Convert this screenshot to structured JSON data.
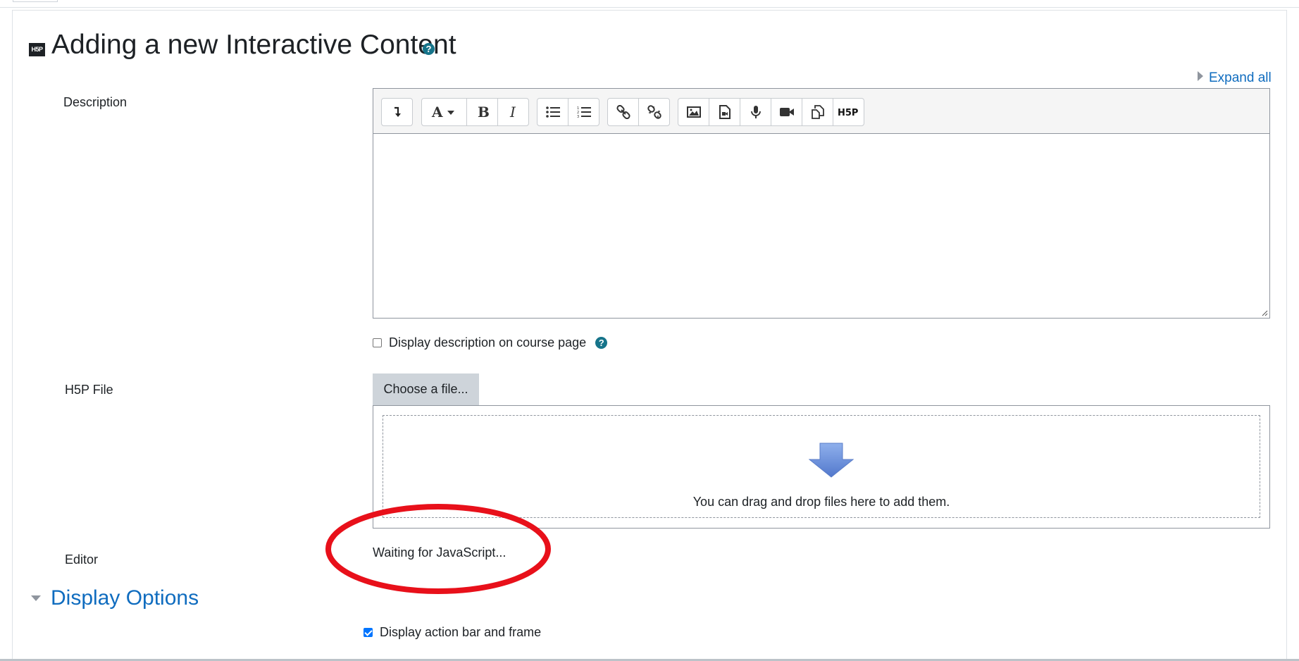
{
  "page": {
    "logo_text": "H5P",
    "title": "Adding a new Interactive Content",
    "help_glyph": "?",
    "expand_all": "Expand all"
  },
  "description": {
    "label": "Description",
    "toolbar": [
      {
        "name": "show-more-buttons-icon",
        "glyph": "↴"
      },
      {
        "name": "font-style-icon",
        "glyph": "A▾"
      },
      {
        "name": "bold-icon",
        "glyph": "B"
      },
      {
        "name": "italic-icon",
        "glyph": "I"
      },
      {
        "name": "unordered-list-icon",
        "glyph": "☰"
      },
      {
        "name": "ordered-list-icon",
        "glyph": "☷"
      },
      {
        "name": "link-icon",
        "glyph": "🔗"
      },
      {
        "name": "unlink-icon",
        "glyph": "⛓"
      },
      {
        "name": "image-icon",
        "glyph": "🖼"
      },
      {
        "name": "media-icon",
        "glyph": "▶"
      },
      {
        "name": "record-audio-icon",
        "glyph": "🎙"
      },
      {
        "name": "record-video-icon",
        "glyph": "■"
      },
      {
        "name": "manage-files-icon",
        "glyph": "⧉"
      },
      {
        "name": "h5p-icon",
        "glyph": "H5P"
      }
    ],
    "content": "",
    "show_on_course_page": {
      "label": "Display description on course page",
      "checked": false
    }
  },
  "h5p_file": {
    "label": "H5P File",
    "choose_button": "Choose a file...",
    "drop_text": "You can drag and drop files here to add them."
  },
  "editor": {
    "label": "Editor",
    "status": "Waiting for JavaScript..."
  },
  "display_options": {
    "title": "Display Options",
    "action_bar": {
      "label": "Display action bar and frame",
      "checked": true
    }
  },
  "colors": {
    "link": "#0f6cbf",
    "help_icon": "#16748a",
    "annotation_circle": "#e8101a",
    "drop_arrow": "#6b8fd6"
  }
}
